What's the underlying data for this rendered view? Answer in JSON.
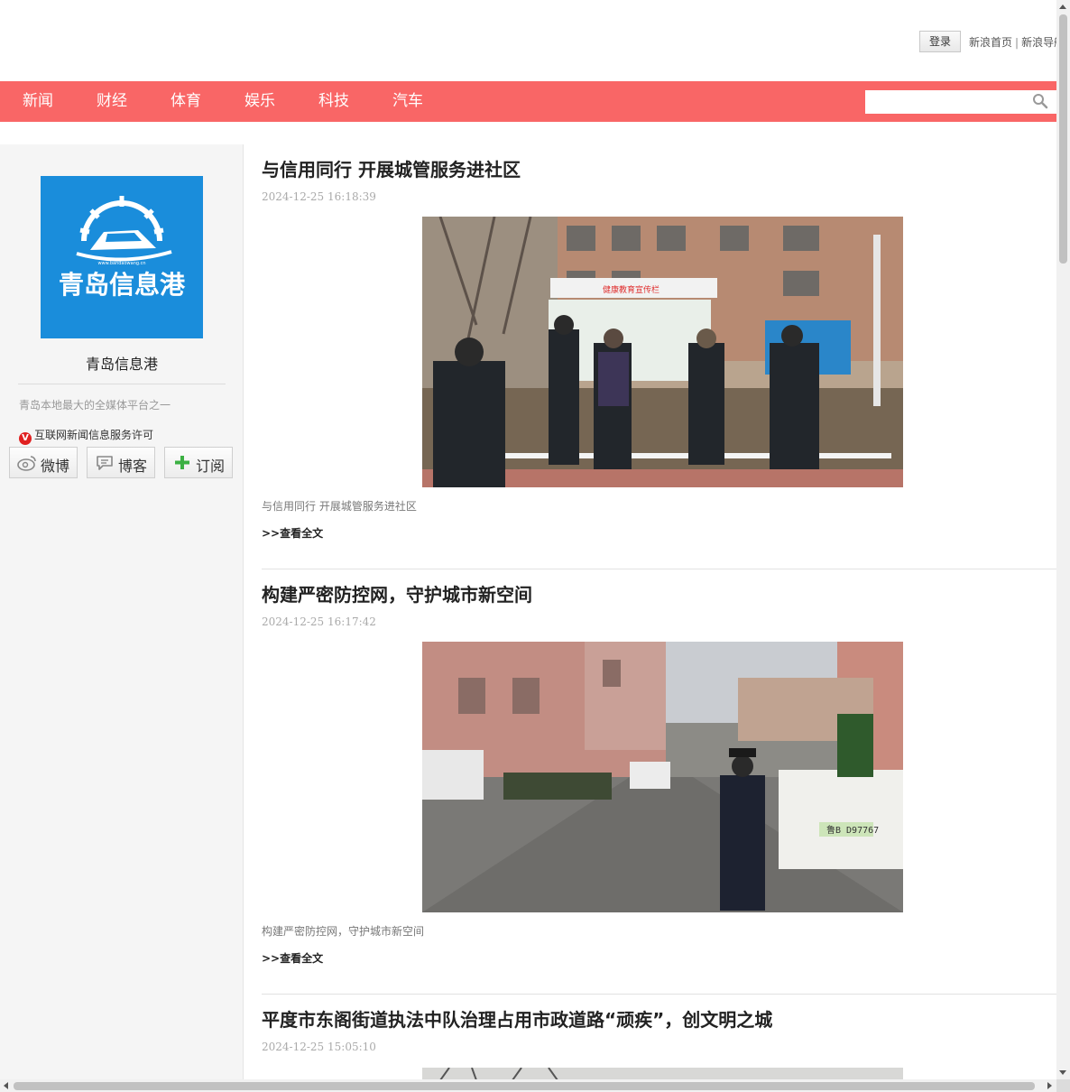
{
  "header": {
    "login_label": "登录",
    "links": [
      "新浪首页",
      "新浪导航"
    ],
    "separator": "|"
  },
  "nav": {
    "items": [
      "新闻",
      "财经",
      "体育",
      "娱乐",
      "科技",
      "汽车"
    ],
    "search_value": "",
    "bg_color": "#f96666"
  },
  "sidebar": {
    "logo_text": "青岛信息港",
    "logo_url_text": "www.bandaowang.cn",
    "blog_name": "青岛信息港",
    "description": "青岛本地最大的全媒体平台之一",
    "license_badge": "V",
    "license": "互联网新闻信息服务许可",
    "buttons": [
      {
        "label": "微博",
        "icon": "weibo-icon"
      },
      {
        "label": "博客",
        "icon": "blog-icon"
      },
      {
        "label": "订阅",
        "icon": "plus-icon"
      }
    ]
  },
  "articles": [
    {
      "title": "与信用同行 开展城管服务进社区",
      "date": "2024-12-25 16:18:39",
      "image_sign": "健康教育宣传栏",
      "caption": "与信用同行 开展城管服务进社区",
      "read_more": ">>查看全文"
    },
    {
      "title": "构建严密防控网，守护城市新空间",
      "date": "2024-12-25 16:17:42",
      "image_plate": "鲁B D97767",
      "caption": "构建严密防控网，守护城市新空间",
      "read_more": ">>查看全文"
    },
    {
      "title": "平度市东阁街道执法中队治理占用市政道路“顽疾”，创文明之城",
      "date": "2024-12-25 15:05:10"
    }
  ]
}
